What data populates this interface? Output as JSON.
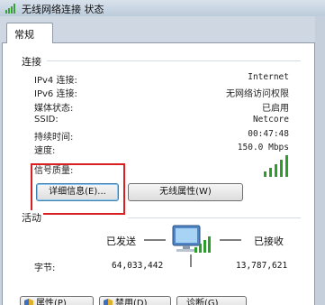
{
  "window": {
    "title": "无线网络连接 状态"
  },
  "tabs": [
    {
      "label": "常规"
    }
  ],
  "connection": {
    "group_label": "连接",
    "rows": [
      {
        "label": "IPv4 连接:",
        "value": "Internet"
      },
      {
        "label": "IPv6 连接:",
        "value": "无网络访问权限"
      },
      {
        "label": "媒体状态:",
        "value": "已启用"
      },
      {
        "label": "SSID:",
        "value": "Netcore"
      },
      {
        "label": "持续时间:",
        "value": "00:47:48"
      },
      {
        "label": "速度:",
        "value": "150.0 Mbps"
      }
    ],
    "signal_label": "信号质量:",
    "signal_bars": 5,
    "details_button": "详细信息(E)...",
    "wireless_props_button": "无线属性(W)"
  },
  "activity": {
    "group_label": "活动",
    "sent_label": "已发送",
    "received_label": "已接收",
    "bytes_label": "字节:",
    "bytes_sent": "64,033,442",
    "bytes_received": "13,787,621"
  },
  "bottom_buttons": {
    "properties": "属性(P)",
    "disable": "禁用(D)",
    "diagnose": "诊断(G)"
  },
  "colors": {
    "highlight_box": "#d91f1f",
    "signal_green": "#2e9d2e",
    "focus_blue": "#3c7fb1"
  }
}
